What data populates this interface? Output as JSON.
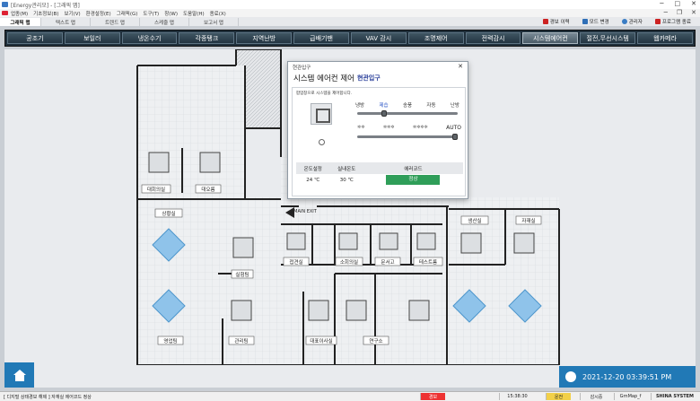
{
  "window": {
    "title": "[Energy관리모] - [그래픽 맵]"
  },
  "menu": [
    "업종(M)",
    "기초정보(B)",
    "보기(V)",
    "환경설정(E)",
    "그래픽(G)",
    "도구(T)",
    "창(W)",
    "도움말(H)",
    "종료(X)"
  ],
  "doc_tabs": [
    "그래픽 맵",
    "텍스트 맵",
    "트렌드 맵",
    "스케줄 맵",
    "보고서 맵"
  ],
  "toolbar": {
    "alarm": "경보 이력",
    "mode": "모드 변경",
    "admin": "관리자",
    "exit": "프로그램 종료"
  },
  "nav": [
    "공조기",
    "보일러",
    "냉온수기",
    "각종탱크",
    "지역난방",
    "급배기팬",
    "VAV 감시",
    "조명제어",
    "전력감시",
    "시스템에어컨",
    "절전,무선시스템",
    "웹카메라"
  ],
  "nav_active": 9,
  "rooms": {
    "r1": "대회의실",
    "r2": "대오름",
    "r3": "상황실",
    "r4": "화장실",
    "r5": "접견실",
    "r6": "소회의실",
    "r7": "문서고",
    "r8": "테스트룸",
    "r9": "생산실",
    "r10": "자재실",
    "r11": "영업팀",
    "r12": "관리팀",
    "r13": "대표이사실",
    "r14": "연구소",
    "r15": "실험팀"
  },
  "exit_label": "MAIN EXIT",
  "dialog": {
    "window_title": "현관입구",
    "heading": "시스템 에어컨 제어",
    "subheading": "현관입구",
    "description": "팝업창으로 시스템을 제어합니다.",
    "modes": [
      "냉방",
      "제습",
      "송풍",
      "자동",
      "난방"
    ],
    "mode_selected": 1,
    "fan_auto": "AUTO",
    "fan_level": 1.0,
    "headers": [
      "온도설정",
      "실내온도",
      "에러코드"
    ],
    "set_temp": "24 ℃",
    "room_temp": "30 ℃",
    "error_code": "정상"
  },
  "datetime": "2021-12-20 03:39:51 PM",
  "status": {
    "message": "[ 디지털 상태경보 해제 ] 자재실 에어코드 정상",
    "alarm": "경보",
    "time": "15:38:30",
    "mode": "운전",
    "monitor": "감시중",
    "map": "GrnMap_f",
    "company": "SHINA SYSTEM"
  },
  "colors": {
    "nav_bg": "#20303c",
    "accent_blue": "#2179b6",
    "error_ok": "#2f9e59",
    "alarm_red": "#e33",
    "mode_yellow": "#f2d048"
  }
}
